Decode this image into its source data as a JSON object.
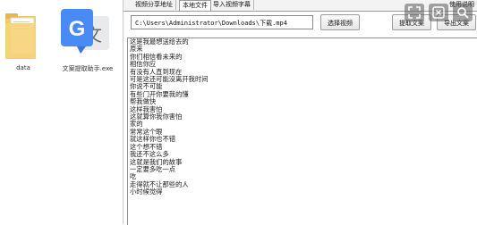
{
  "desktop": {
    "folder_label": "data",
    "app_label": "文案提取助手.exe",
    "app_icon_letter": "G",
    "app_icon_glyph": "文"
  },
  "app": {
    "tabs": [
      "视频分享地址",
      "本地文件",
      "导入视频字幕"
    ],
    "tab_right": "使用说明",
    "path_value": "C:\\Users\\Administrator\\Downloads\\下载.mp4",
    "select_button": "选择视频",
    "extract_button_1": "提取文案",
    "extract_button_2": "导出文案",
    "lines": [
      "这是我最想送给去的",
      "原来",
      "你们相信看未来的",
      "相信你应",
      "有没有人直到现在",
      "可是这还可能没离开我时间",
      "你说不可能",
      "有些门开你要我的懂",
      "帮我做快",
      "这样我害怕",
      "这就算你我你害怕",
      "家的",
      "常常这个眼",
      "就这样你也不错",
      "这个想不错",
      "我还不这么多",
      "这就是我们的故事",
      "一定要多吃一点",
      "吃",
      "走得就不让那些的人",
      "小时候觉得"
    ]
  },
  "overlay_icons": [
    "expand-icon",
    "close-icon",
    "search-icon"
  ]
}
